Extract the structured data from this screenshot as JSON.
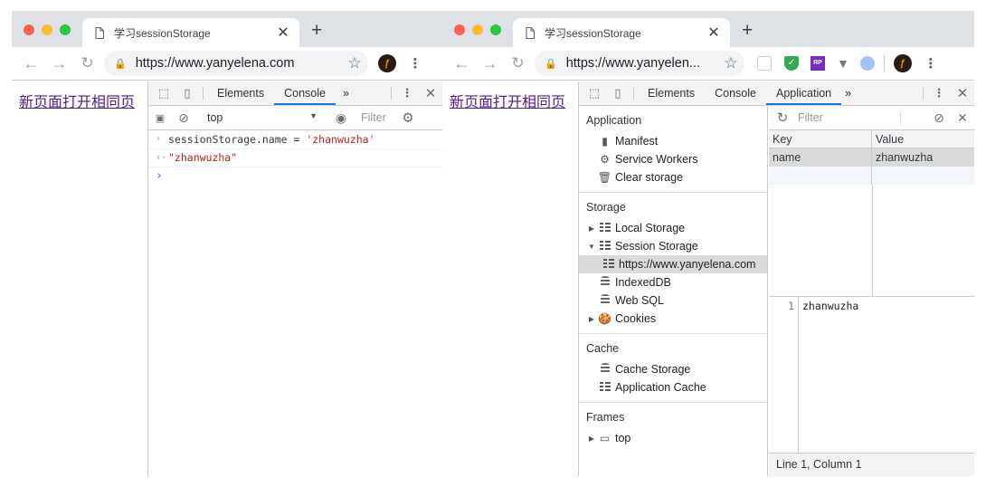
{
  "colors": {
    "close": "#ff5f57",
    "minimize": "#febc2e",
    "zoom": "#28c840",
    "accent": "#1a73e8"
  },
  "left": {
    "tab_title": "学习sessionStorage",
    "url": "https://www.yanyelena.com",
    "page_link": "新页面打开相同页",
    "devtools_tabs": [
      "Elements",
      "Console"
    ],
    "active_tab": "Console",
    "more_tabs": "»",
    "context": "top",
    "filter_placeholder": "Filter",
    "console_input": "sessionStorage.name = ",
    "console_input_str": "'zhanwuzha'",
    "console_result": "\"zhanwuzha\"",
    "prompt": "›"
  },
  "right": {
    "tab_title": "学习sessionStorage",
    "url": "https://www.yanyelen...",
    "page_link": "新页面打开相同页",
    "devtools_tabs": [
      "Elements",
      "Console",
      "Application"
    ],
    "active_tab": "Application",
    "more_tabs": "»",
    "sections": {
      "application": {
        "title": "Application",
        "items": [
          "Manifest",
          "Service Workers",
          "Clear storage"
        ]
      },
      "storage": {
        "title": "Storage",
        "items": [
          "Local Storage",
          "Session Storage",
          "https://www.yanyelena.com",
          "IndexedDB",
          "Web SQL",
          "Cookies"
        ]
      },
      "cache": {
        "title": "Cache",
        "items": [
          "Cache Storage",
          "Application Cache"
        ]
      },
      "frames": {
        "title": "Frames",
        "items": [
          "top"
        ]
      }
    },
    "filter_placeholder": "Filter",
    "columns": {
      "key": "Key",
      "value": "Value"
    },
    "rows": [
      {
        "key": "name",
        "value": "zhanwuzha"
      }
    ],
    "preview_line_no": "1",
    "preview_text": "zhanwuzha",
    "status": "Line 1, Column 1"
  }
}
